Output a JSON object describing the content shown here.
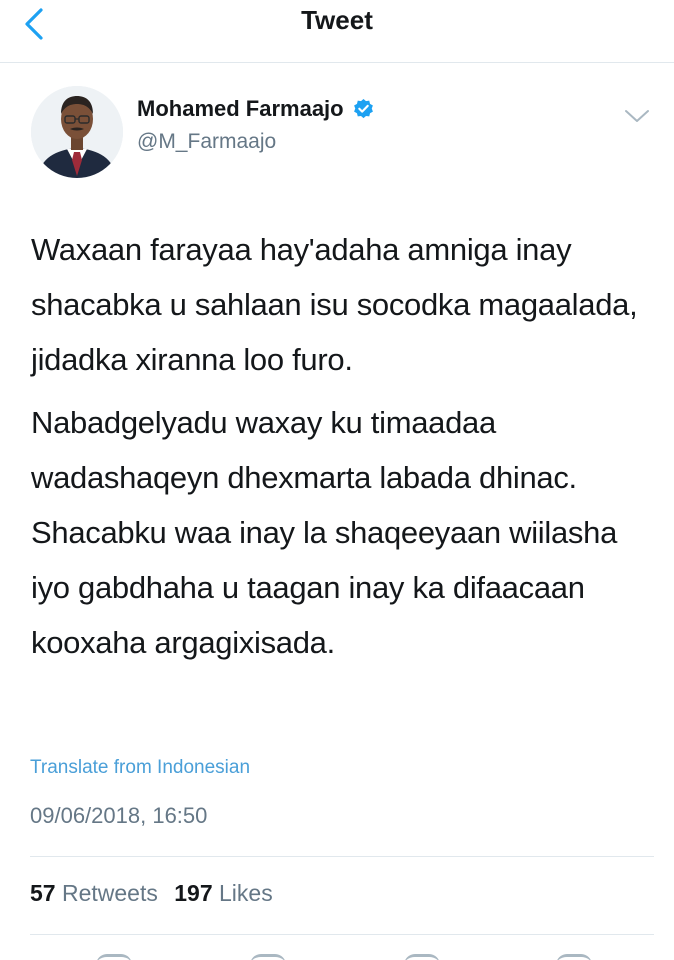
{
  "header": {
    "title": "Tweet",
    "back_icon": "chevron-left-icon"
  },
  "author": {
    "name": "Mohamed Farmaajo",
    "handle": "@M_Farmaajo",
    "verified": true,
    "verified_icon": "verified-badge-icon"
  },
  "tweet": {
    "paragraphs": [
      "Waxaan farayaa hay'adaha amniga inay shacabka u sahlaan isu socodka magaalada, jidadka xiranna loo furo.",
      "Nabadgelyadu waxay ku timaadaa wadashaqeyn dhexmarta labada dhinac. Shacabku waa inay la shaqeeyaan wiilasha iyo gabdhaha u taagan inay ka difaacaan kooxaha argagixisada."
    ],
    "translate_label": "Translate from Indonesian",
    "timestamp": "09/06/2018, 16:50"
  },
  "stats": {
    "retweets_count": "57",
    "retweets_label": "Retweets",
    "likes_count": "197",
    "likes_label": "Likes"
  },
  "colors": {
    "link": "#4a9fd8",
    "verified": "#1da1f2",
    "secondary_text": "#657786",
    "divider": "#e1e8ed"
  }
}
